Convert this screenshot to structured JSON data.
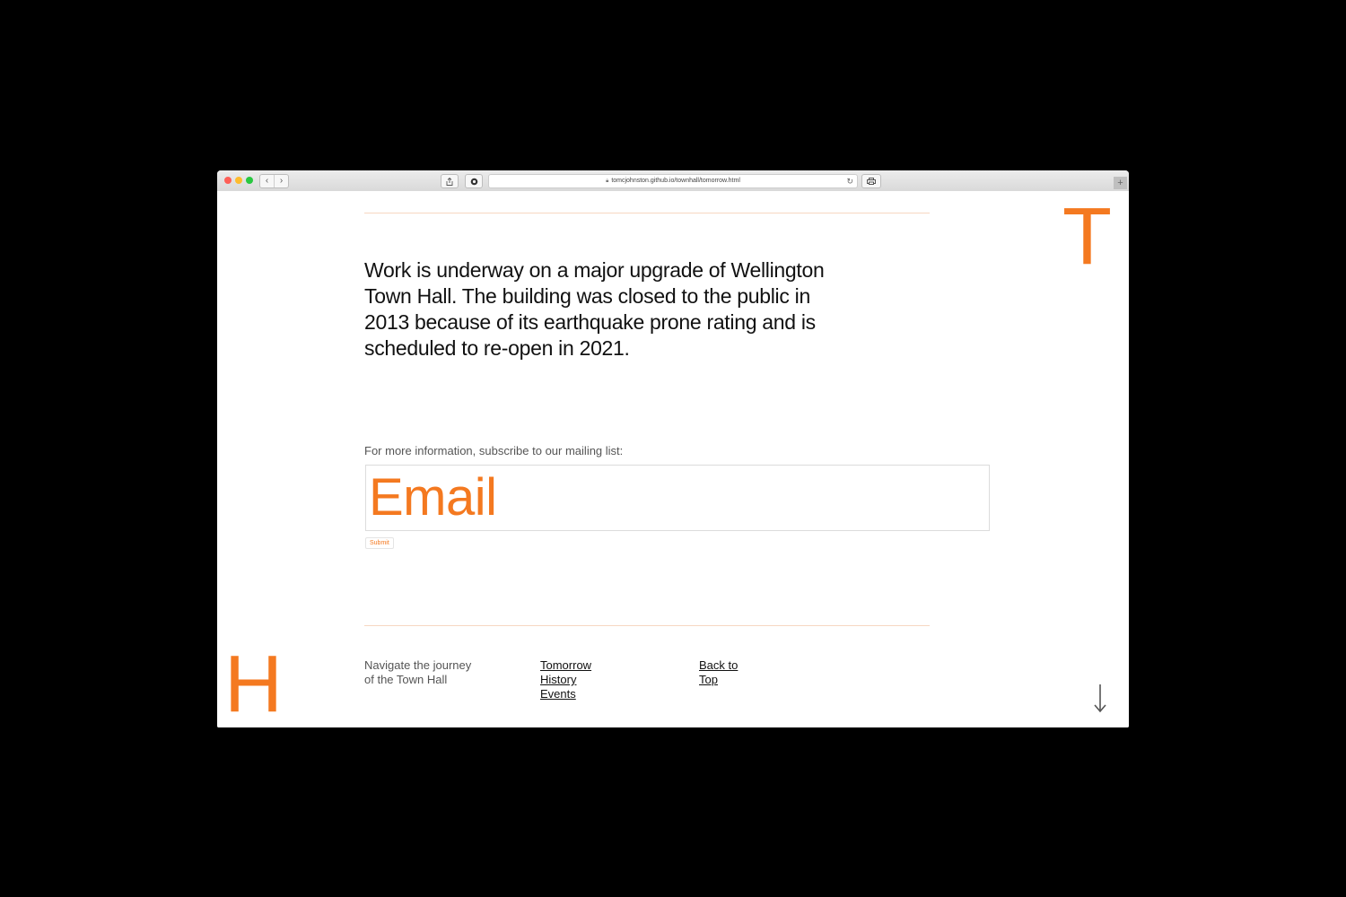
{
  "browser": {
    "url": "tomcjohnston.github.io/townhall/tomorrow.html",
    "nav_back_icon": "chevron-left-icon",
    "nav_forward_icon": "chevron-right-icon"
  },
  "page": {
    "corner_letter_top": "T",
    "corner_letter_bottom": "H",
    "intro_text": "Work is underway on a major upgrade of Wellington Town Hall. The building was closed to the public in 2013 because of its earthquake prone rating and is scheduled to re-open in 2021.",
    "subscribe_label": "For more information, subscribe to our mailing list:",
    "email_placeholder": "Email",
    "submit_label": "Submit"
  },
  "footer": {
    "nav_caption_line1": "Navigate the journey",
    "nav_caption_line2": "of the Town Hall",
    "links": [
      "Tomorrow",
      "History",
      "Events"
    ],
    "back_to_top_line1": "Back to",
    "back_to_top_line2": "Top"
  },
  "colors": {
    "accent": "#f47920",
    "page_background": "#000000"
  }
}
